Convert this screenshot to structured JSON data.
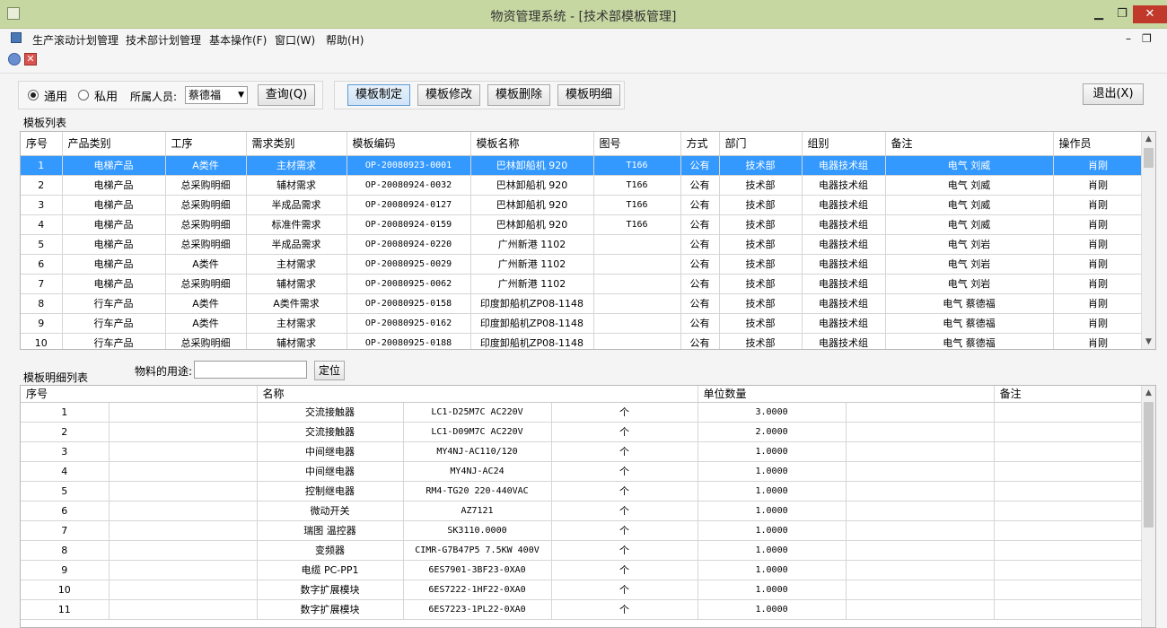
{
  "window": {
    "title": "物资管理系统 - [技术部模板管理]",
    "min_glyph": "▁",
    "max_glyph": "❐",
    "close_glyph": "✕",
    "close_color": "#c0392b"
  },
  "menu": {
    "items": [
      "生产滚动计划管理",
      "技术部计划管理",
      "基本操作(F)",
      "窗口(W)",
      "帮助(H)"
    ],
    "mdi_min": "–",
    "mdi_restore": "❐"
  },
  "toolbar": {
    "icon1": "refresh-icon",
    "icon2": "close-icon",
    "icon2_glyph": "✕"
  },
  "filter": {
    "radio_public": "通用",
    "radio_private": "私用",
    "selected_radio": "通用",
    "person_label": "所属人员:",
    "person_value": "蔡德福",
    "query_button": "查询(Q)"
  },
  "actions": {
    "create": "模板制定",
    "modify": "模板修改",
    "delete": "模板删除",
    "detail": "模板明细",
    "exit": "退出(X)"
  },
  "template_list": {
    "label": "模板列表",
    "columns": [
      "序号",
      "产品类别",
      "工序",
      "需求类别",
      "模板编码",
      "模板名称",
      "图号",
      "方式",
      "部门",
      "组别",
      "备注",
      "操作员"
    ],
    "rows": [
      [
        "1",
        "电梯产品",
        "A类件",
        "主材需求",
        "OP-20080923-0001",
        "巴林卸船机 920",
        "T166",
        "公有",
        "技术部",
        "电器技术组",
        "电气 刘威",
        "肖刚"
      ],
      [
        "2",
        "电梯产品",
        "总采购明细",
        "辅材需求",
        "OP-20080924-0032",
        "巴林卸船机 920",
        "T166",
        "公有",
        "技术部",
        "电器技术组",
        "电气 刘威",
        "肖刚"
      ],
      [
        "3",
        "电梯产品",
        "总采购明细",
        "半成品需求",
        "OP-20080924-0127",
        "巴林卸船机 920",
        "T166",
        "公有",
        "技术部",
        "电器技术组",
        "电气 刘威",
        "肖刚"
      ],
      [
        "4",
        "电梯产品",
        "总采购明细",
        "标准件需求",
        "OP-20080924-0159",
        "巴林卸船机 920",
        "T166",
        "公有",
        "技术部",
        "电器技术组",
        "电气 刘威",
        "肖刚"
      ],
      [
        "5",
        "电梯产品",
        "总采购明细",
        "半成品需求",
        "OP-20080924-0220",
        "广州新港 1102",
        "",
        "公有",
        "技术部",
        "电器技术组",
        "电气 刘岩",
        "肖刚"
      ],
      [
        "6",
        "电梯产品",
        "A类件",
        "主材需求",
        "OP-20080925-0029",
        "广州新港 1102",
        "",
        "公有",
        "技术部",
        "电器技术组",
        "电气 刘岩",
        "肖刚"
      ],
      [
        "7",
        "电梯产品",
        "总采购明细",
        "辅材需求",
        "OP-20080925-0062",
        "广州新港 1102",
        "",
        "公有",
        "技术部",
        "电器技术组",
        "电气 刘岩",
        "肖刚"
      ],
      [
        "8",
        "行车产品",
        "A类件",
        "A类件需求",
        "OP-20080925-0158",
        "印度卸船机ZP08-1148",
        "",
        "公有",
        "技术部",
        "电器技术组",
        "电气 蔡德福",
        "肖刚"
      ],
      [
        "9",
        "行车产品",
        "A类件",
        "主材需求",
        "OP-20080925-0162",
        "印度卸船机ZP08-1148",
        "",
        "公有",
        "技术部",
        "电器技术组",
        "电气 蔡德福",
        "肖刚"
      ],
      [
        "10",
        "行车产品",
        "总采购明细",
        "辅材需求",
        "OP-20080925-0188",
        "印度卸船机ZP08-1148",
        "",
        "公有",
        "技术部",
        "电器技术组",
        "电气 蔡德福",
        "肖刚"
      ]
    ],
    "selected_row": 0
  },
  "detail_list": {
    "label": "模板明细列表",
    "purpose_label": "物料的用途:",
    "purpose_value": "",
    "locate_button": "定位",
    "columns": [
      "序号",
      "名称",
      "单位数量",
      "备注"
    ],
    "rows": [
      [
        "1",
        "",
        "交流接触器",
        "LC1-D25M7C AC220V",
        "个",
        "3.0000",
        "",
        ""
      ],
      [
        "2",
        "",
        "交流接触器",
        "LC1-D09M7C AC220V",
        "个",
        "2.0000",
        "",
        ""
      ],
      [
        "3",
        "",
        "中间继电器",
        "MY4NJ-AC110/120",
        "个",
        "1.0000",
        "",
        ""
      ],
      [
        "4",
        "",
        "中间继电器",
        "MY4NJ-AC24",
        "个",
        "1.0000",
        "",
        ""
      ],
      [
        "5",
        "",
        "控制继电器",
        "RM4-TG20 220-440VAC",
        "个",
        "1.0000",
        "",
        ""
      ],
      [
        "6",
        "",
        "微动开关",
        "AZ7121",
        "个",
        "1.0000",
        "",
        ""
      ],
      [
        "7",
        "",
        "瑞图 温控器",
        "SK3110.0000",
        "个",
        "1.0000",
        "",
        ""
      ],
      [
        "8",
        "",
        "变频器",
        "CIMR-G7B47P5 7.5KW 400V",
        "个",
        "1.0000",
        "",
        ""
      ],
      [
        "9",
        "",
        "电缆 PC-PP1",
        "6ES7901-3BF23-0XA0",
        "个",
        "1.0000",
        "",
        ""
      ],
      [
        "10",
        "",
        "数字扩展模块",
        "6ES7222-1HF22-0XA0",
        "个",
        "1.0000",
        "",
        ""
      ],
      [
        "11",
        "",
        "数字扩展模块",
        "6ES7223-1PL22-0XA0",
        "个",
        "1.0000",
        "",
        ""
      ]
    ]
  },
  "scroll": {
    "up": "▲",
    "down": "▼"
  }
}
